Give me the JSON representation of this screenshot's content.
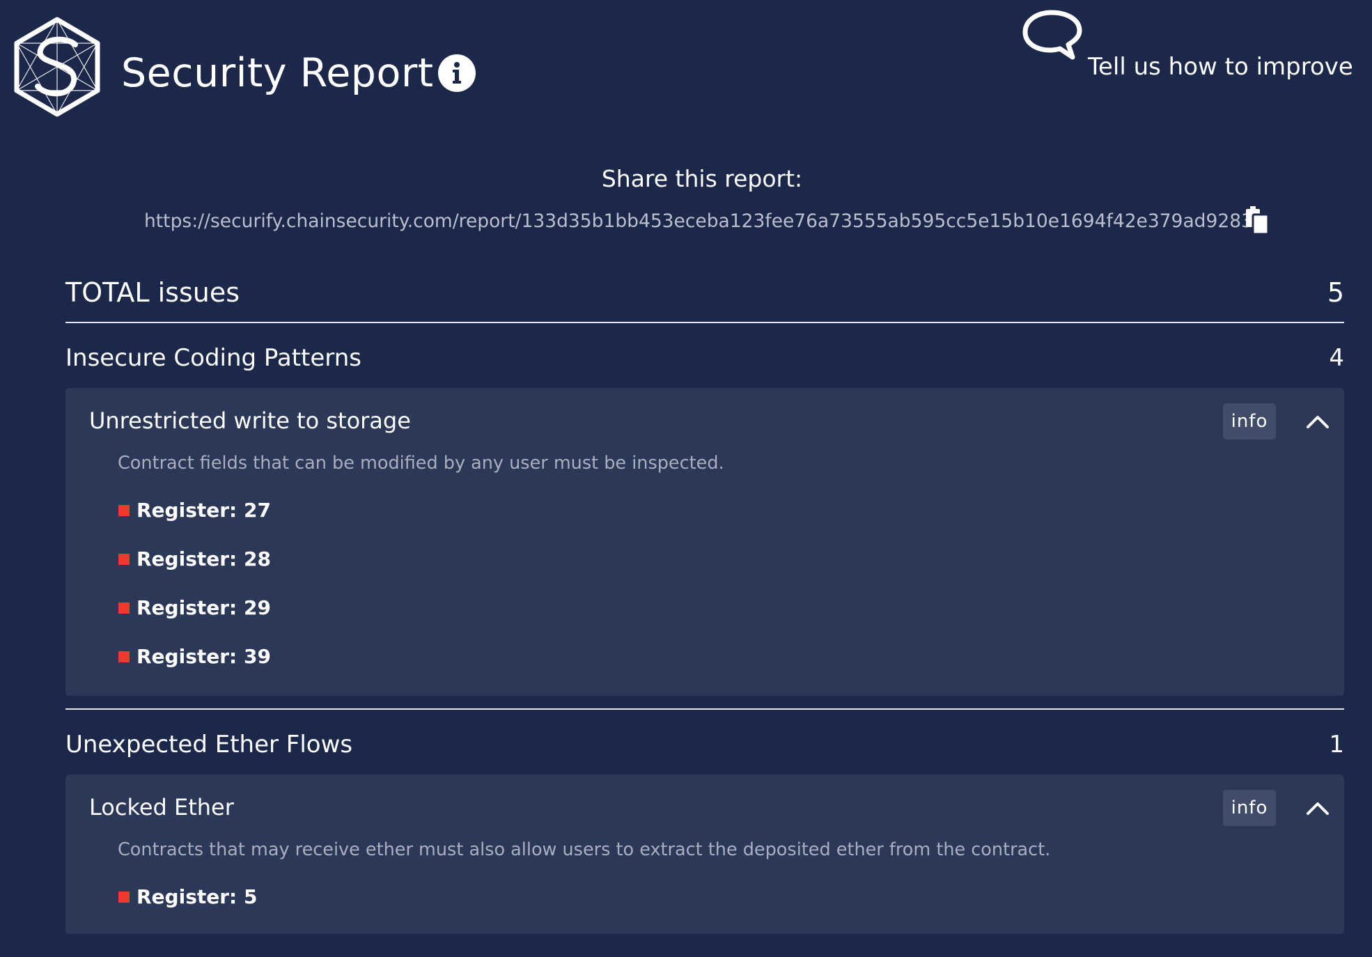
{
  "header": {
    "title": "Security Report",
    "logo_icon": "securify-hexagon-logo",
    "info_icon": "info-circle-icon",
    "feedback": {
      "label": "Tell us how to improve",
      "icon": "speech-bubble-icon"
    }
  },
  "share": {
    "title": "Share this report:",
    "url": "https://securify.chainsecurity.com/report/133d35b1bb453eceba123fee76a73555ab595cc5e15b10e1694f42e379ad9283",
    "copy_icon": "clipboard-copy-icon"
  },
  "summary": {
    "total_label": "TOTAL issues",
    "total_count": "5"
  },
  "categories": [
    {
      "name": "Insecure Coding Patterns",
      "count": "4",
      "issues": [
        {
          "title": "Unrestricted write to storage",
          "info_label": "info",
          "expanded": true,
          "description": "Contract fields that can be modified by any user must be inspected.",
          "findings": [
            "Register: 27",
            "Register: 28",
            "Register: 29",
            "Register: 39"
          ]
        }
      ]
    },
    {
      "name": "Unexpected Ether Flows",
      "count": "1",
      "issues": [
        {
          "title": "Locked Ether",
          "info_label": "info",
          "expanded": true,
          "description": "Contracts that may receive ether must also allow users to extract the deposited ether from the contract.",
          "findings": [
            "Register: 5"
          ]
        }
      ]
    }
  ],
  "colors": {
    "background": "#1c2849",
    "card": "#2c3858",
    "info_button": "#414c69",
    "finding_bullet": "#ee3a2d",
    "muted_text": "#a9afbf"
  }
}
